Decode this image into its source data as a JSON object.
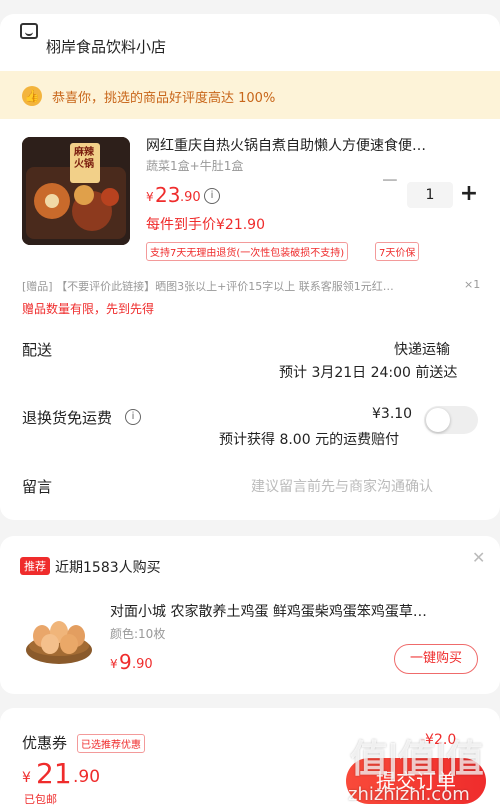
{
  "store": {
    "name": "栩岸食品饮料小店"
  },
  "banner": {
    "text": "恭喜你，挑选的商品好评度高达 100%"
  },
  "product": {
    "title": "网红重庆自热火锅自煮自助懒人方便速食便…",
    "spec": "蔬菜1盒+牛肚1盒",
    "currency": "¥",
    "price_int": "23",
    "price_dec": ".90",
    "each_price": "每件到手价¥21.90",
    "quantity": "1",
    "tags": [
      "支持7天无理由退货(一次性包装破损不支持)",
      "7天价保"
    ],
    "img_text": "麻辣火锅"
  },
  "gift": {
    "text": "[赠品] 【不要评价此链接】晒图3张以上+评价15字以上 联系客服领1元红…",
    "count": "×1",
    "note": "赠品数量有限，先到先得"
  },
  "delivery": {
    "label": "配送",
    "method": "快递运输",
    "eta": "预计 3月21日 24:00 前送达"
  },
  "return_fee": {
    "label": "退换货免运费",
    "price": "¥3.10",
    "compensation": "预计获得 8.00 元的运费赔付",
    "toggle_on": false
  },
  "message": {
    "label": "留言",
    "placeholder": "建议留言前先与商家沟通确认"
  },
  "recommend": {
    "badge": "推荐",
    "headline": "近期1583人购买",
    "item_title": "对面小城 农家散养土鸡蛋 鲜鸡蛋柴鸡蛋笨鸡蛋草…",
    "item_spec": "颜色:10枚",
    "currency": "¥",
    "price_int": "9",
    "price_dec": ".90",
    "buy_label": "一键购买"
  },
  "coupon": {
    "label": "优惠券",
    "tag": "已选推荐优惠",
    "value": "-¥2.0"
  },
  "footer": {
    "currency": "¥",
    "total_int": "21",
    "total_dec": ".90",
    "shipping": "已包邮",
    "submit_label": "提交订单"
  },
  "watermark": {
    "logo": "值|值|值",
    "site": "zhizhizhi.com"
  },
  "colors": {
    "accent": "#ef2c2c",
    "banner_bg": "#fdf3d8"
  }
}
